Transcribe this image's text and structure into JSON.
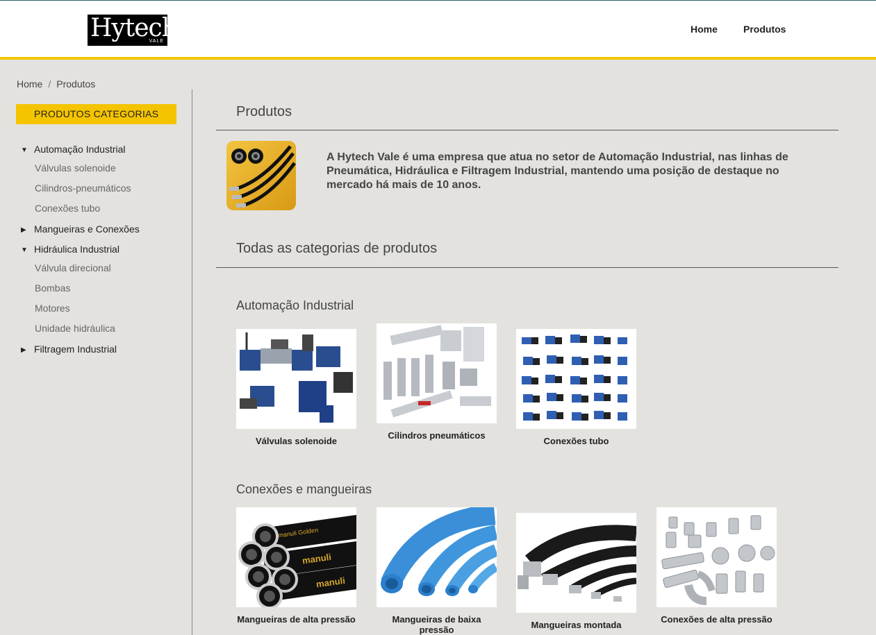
{
  "header": {
    "logo_text": "Hytech",
    "logo_sub": "VALE",
    "nav": [
      {
        "label": "Home"
      },
      {
        "label": "Produtos"
      }
    ]
  },
  "breadcrumb": {
    "items": [
      "Home",
      "Produtos"
    ],
    "separator": "/"
  },
  "sidebar": {
    "title": "PRODUTOS CATEGORIAS",
    "categories": [
      {
        "label": "Automação Industrial",
        "expanded": true,
        "children": [
          "Válvulas solenoide",
          "Cilindros-pneumáticos",
          "Conexões tubo"
        ]
      },
      {
        "label": "Mangueiras e Conexões",
        "expanded": false,
        "children": []
      },
      {
        "label": "Hidráulica Industrial",
        "expanded": true,
        "children": [
          "Válvula direcional",
          "Bombas",
          "Motores",
          "Unidade hidráulica"
        ]
      },
      {
        "label": "Filtragem Industrial",
        "expanded": false,
        "children": []
      }
    ],
    "icons": {
      "expanded": "▼",
      "collapsed": "▶"
    }
  },
  "main": {
    "title": "Produtos",
    "intro": "A Hytech Vale é uma empresa que atua no setor de Automação Industrial, nas linhas de Pneumática, Hidráulica e Filtragem Industrial, mantendo uma posição de destaque no mercado há mais de 10 anos.",
    "all_title": "Todas as categorias de produtos",
    "groups": [
      {
        "title": "Automação Industrial",
        "products": [
          {
            "label": "Válvulas solenoide",
            "image": "solenoid-valves-image"
          },
          {
            "label": "Cilindros pneumáticos",
            "image": "pneumatic-cylinders-image"
          },
          {
            "label": "Conexões tubo",
            "image": "tube-fittings-image"
          }
        ]
      },
      {
        "title": "Conexões e mangueiras",
        "products": [
          {
            "label": "Mangueiras de alta pressão",
            "image": "high-pressure-hoses-image",
            "brand": "manuli",
            "brand_line": "manuli Golden"
          },
          {
            "label": "Mangueiras de baixa pressão",
            "image": "low-pressure-hoses-image"
          },
          {
            "label": "Mangueiras montada",
            "image": "assembled-hoses-image"
          },
          {
            "label": "Conexões de alta pressão",
            "image": "high-pressure-fittings-image"
          }
        ]
      }
    ]
  },
  "colors": {
    "accent": "#f5c400",
    "background": "#e3e2df",
    "header_border": "#2b5d6b",
    "valve_blue": "#2a4d8f",
    "hose_blue": "#3a8fd8"
  }
}
